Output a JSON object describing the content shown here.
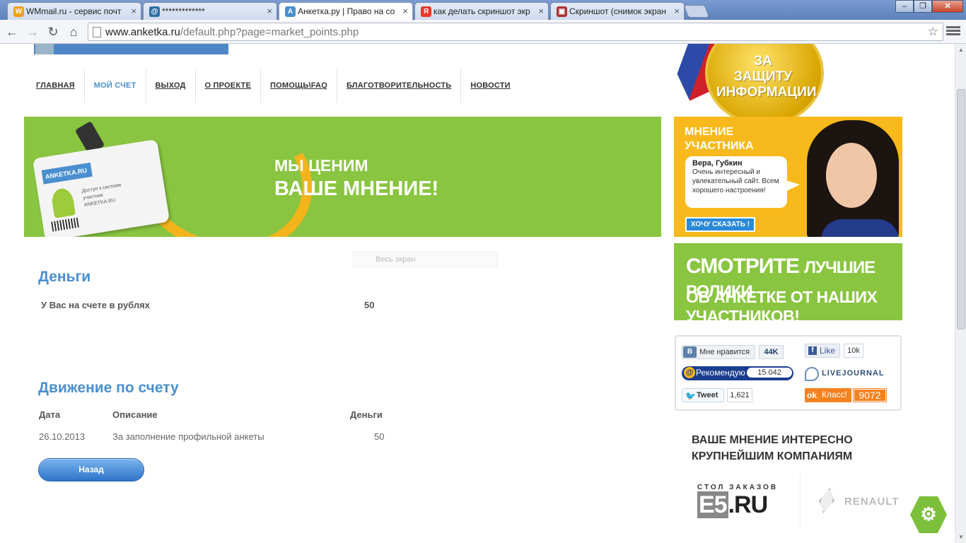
{
  "browser": {
    "tabs": [
      {
        "title": "WMmail.ru - сервис почт",
        "favicon": "wmmail-icon"
      },
      {
        "title": "*************",
        "favicon": "mail-icon"
      },
      {
        "title": "Анкетка.ру | Право на со",
        "favicon": "anketka-icon"
      },
      {
        "title": "как делать скриншот экр",
        "favicon": "yandex-icon"
      },
      {
        "title": "Скриншот (снимок экран",
        "favicon": "screenshot-site-icon"
      }
    ],
    "url_host": "www.anketka.ru",
    "url_path": "/default.php?page=market_points.php"
  },
  "nav": {
    "items": [
      "ГЛАВНАЯ",
      "МОЙ СЧЕТ",
      "ВЫХОД",
      "О ПРОЕКТЕ",
      "ПОМОЩЬ\\FAQ",
      "БЛАГОТВОРИТЕЛЬНОСТЬ",
      "НОВОСТИ"
    ]
  },
  "banner": {
    "line1": "МЫ ЦЕНИМ",
    "line2": "ВАШЕ МНЕНИЕ!",
    "card_header": "ANKETKA.RU",
    "card_text1": "Доступ к системе",
    "card_text2": "участник",
    "card_text3": "ANKETKA.RU"
  },
  "search_ghost": "Весь экран",
  "money": {
    "heading": "Деньги",
    "balance_label": "У Вас на счете в рублях",
    "balance_value": "50"
  },
  "movements": {
    "heading": "Движение по счету",
    "columns": [
      "Дата",
      "Описание",
      "Деньги"
    ],
    "rows": [
      {
        "date": "26.10.2013",
        "description": "За заполнение профильной анкеты",
        "amount": "50"
      }
    ],
    "back_button": "Назад"
  },
  "medal": {
    "line1": "ЗА",
    "line2": "ЗАЩИТУ",
    "line3": "ИНФОРМАЦИИ"
  },
  "opinion": {
    "title_line1": "МНЕНИЕ",
    "title_line2": "УЧАСТНИКА",
    "name": "Вера, Губкин",
    "quote": "Очень интересный и увлекательный сайт. Всем хорошего настроения!",
    "button": "ХОЧУ СКАЗАТЬ !"
  },
  "videos": {
    "line1_big": "СМОТРИТЕ",
    "line1_small": "ЛУЧШИЕ РОЛИКИ",
    "line2": "ОБ АНКЕТКЕ ОТ НАШИХ УЧАСТНИКОВ!"
  },
  "social": {
    "vk_label": "Мне нравится",
    "vk_count": "44K",
    "fb_label": "Like",
    "fb_count": "10k",
    "mail_label": "Рекомендую",
    "mail_count": "15 042",
    "lj_label": "LIVEJOURNAL",
    "tw_label": "Tweet",
    "tw_count": "1,621",
    "ok_label": "Класс!",
    "ok_count": "9072"
  },
  "companies": {
    "title": "ВАШЕ МНЕНИЕ ИНТЕРЕСНО КРУПНЕЙШИМ КОМПАНИЯМ",
    "e5_small": "СТОЛ ЗАКАЗОВ",
    "e5_big": "E5",
    "e5_suffix": ".RU",
    "renault": "RENAULT"
  }
}
